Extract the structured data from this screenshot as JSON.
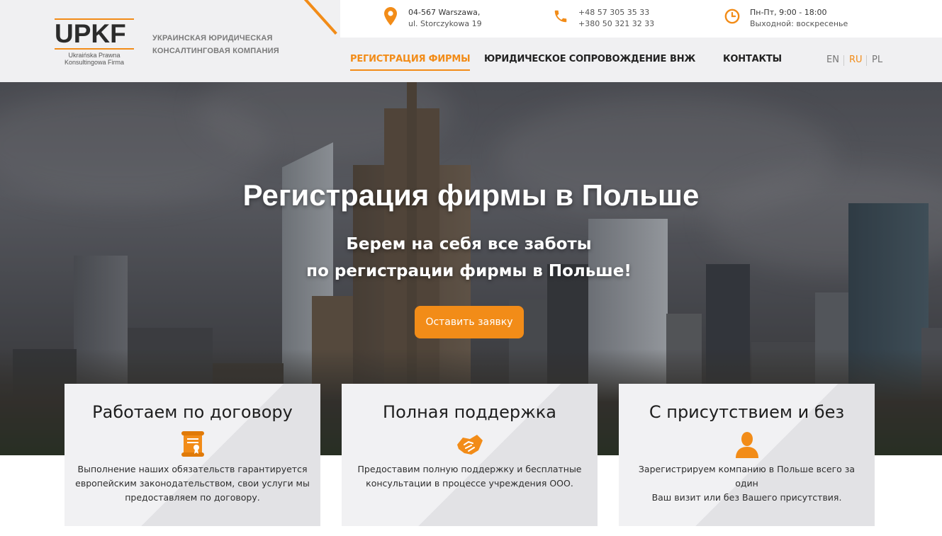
{
  "header": {
    "logo_text": "UPKF",
    "logo_sub_line1": "Ukraińska Prawna",
    "logo_sub_line2": "Konsultingowa Firma",
    "company_line1": "УКРАИНСКАЯ ЮРИДИЧЕСКАЯ",
    "company_line2": "КОНСАЛТИНГОВАЯ КОМПАНИЯ",
    "address_line1": "04-567 Warszawa,",
    "address_line2": "ul. Storczykowa 19",
    "phone_line1": "+48 57 305 35 33",
    "phone_line2": "+380 50 321 32 33",
    "hours_line1": "Пн-Пт, 9:00 - 18:00",
    "hours_line2": "Выходной: воскресенье",
    "accent_color": "#f28c18"
  },
  "nav": {
    "items": [
      {
        "label": "РЕГИСТРАЦИЯ ФИРМЫ",
        "active": true
      },
      {
        "label": "ЮРИДИЧЕСКОЕ СОПРОВОЖДЕНИЕ",
        "active": false
      },
      {
        "label": "ВНЖ",
        "active": false
      },
      {
        "label": "КОНТАКТЫ",
        "active": false
      }
    ],
    "languages": [
      {
        "label": "EN",
        "active": false
      },
      {
        "label": "RU",
        "active": true
      },
      {
        "label": "PL",
        "active": false
      }
    ]
  },
  "hero": {
    "title": "Регистрация фирмы в Польше",
    "subtitle_line1": "Берем на себя все заботы",
    "subtitle_line2": "по регистрации фирмы в Польше!",
    "button_label": "Оставить заявку"
  },
  "cards": [
    {
      "title": "Работаем по договору",
      "icon": "contract-icon",
      "text_line1": "Выполнение наших обязательств гарантируется",
      "text_line2": "европейским законодательством, свои услуги мы",
      "text_line3": "предоставляем по договору."
    },
    {
      "title": "Полная поддержка",
      "icon": "handshake-icon",
      "text_line1": "Предоставим полную поддержку и бесплатные",
      "text_line2": "консультации в процессе учреждения ООО.",
      "text_line3": ""
    },
    {
      "title": "С присутствием и без",
      "icon": "person-icon",
      "text_line1": "Зарегистрируем компанию в Польше всего за один",
      "text_line2": "Ваш визит или без Вашего присутствия.",
      "text_line3": ""
    }
  ]
}
